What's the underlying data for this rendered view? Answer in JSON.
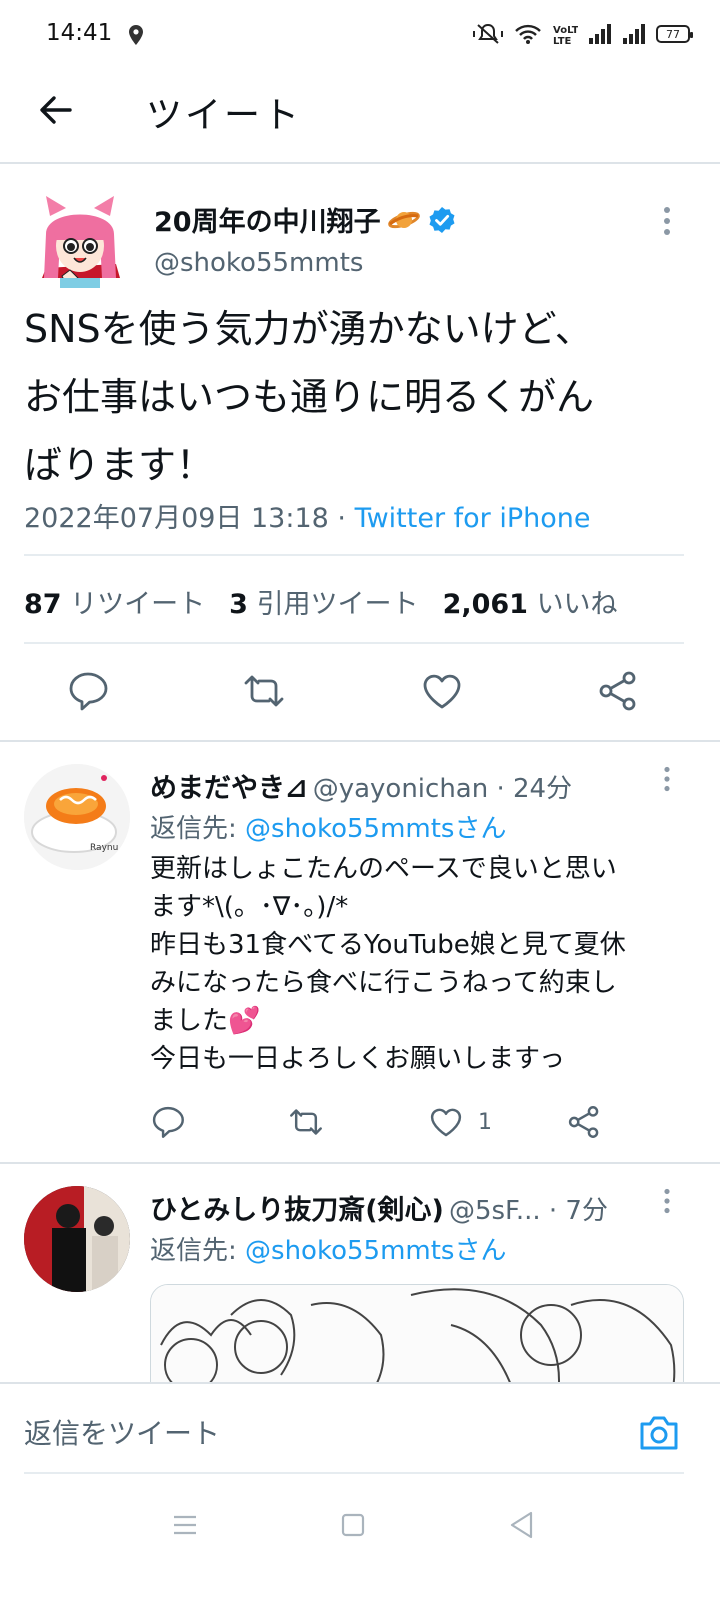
{
  "status_bar": {
    "time": "14:41",
    "battery": "77",
    "icons": [
      "location-icon",
      "mute-icon",
      "wifi-icon",
      "volte-icon",
      "signal-icon",
      "signal-icon",
      "battery-icon"
    ]
  },
  "header": {
    "title": "ツイート",
    "back_icon": "arrow-left-icon"
  },
  "tweet": {
    "author_name": "20周年の中川翔子",
    "author_handle": "@shoko55mmts",
    "verified": true,
    "text_lines": [
      "SNSを使う気力が湧かないけど、",
      "お仕事はいつも通りに明るくがん",
      "ばります！"
    ],
    "timestamp": "2022年07月09日 13:18 · ",
    "source": "Twitter for iPhone",
    "stats": {
      "retweets_count": "87",
      "retweets_label": "リツイート",
      "quotes_count": "3",
      "quotes_label": "引用ツイート",
      "likes_count": "2,061",
      "likes_label": "いいね"
    }
  },
  "replies": [
    {
      "name": "めまだやき⊿",
      "handle": "@yayonichan",
      "time": " · 24分",
      "reply_to_prefix": "返信先: ",
      "reply_to_handle": "@shoko55mmtsさん",
      "text_lines": [
        "更新はしょこたんのペースで良いと思い",
        "ます*\\(。･∇･。)/*",
        "昨日も31食べてるYouTube娘と見て夏休",
        "みになったら食べに行こうねって約束し",
        "ました💕",
        "今日も一日よろしくお願いしますっ"
      ],
      "like_count": "1"
    },
    {
      "name": "ひとみしり抜刀斎(剣心)",
      "handle": "@5sF...",
      "time": " · 7分",
      "reply_to_prefix": "返信先: ",
      "reply_to_handle": "@shoko55mmtsさん"
    }
  ],
  "compose": {
    "placeholder": "返信をツイート"
  },
  "colors": {
    "accent": "#1d9bf0",
    "secondary_text": "#536471",
    "divider": "#e6ecf0",
    "heart_pink": "#e0245e"
  }
}
